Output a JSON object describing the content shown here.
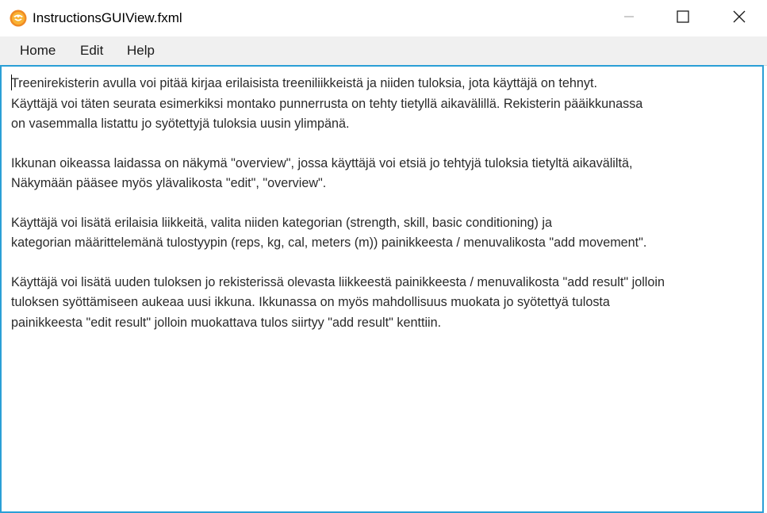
{
  "window": {
    "title": "InstructionsGUIView.fxml",
    "icon": "app-icon",
    "controls": [
      "minimize-icon",
      "maximize-icon",
      "close-icon"
    ]
  },
  "menu": {
    "items": [
      {
        "label": "Home"
      },
      {
        "label": "Edit"
      },
      {
        "label": "Help"
      }
    ]
  },
  "content": {
    "paragraphs": [
      "Treenirekisterin avulla voi pitää kirjaa erilaisista treeniliikkeistä ja niiden tuloksia, jota käyttäjä on tehnyt.\nKäyttäjä voi täten seurata esimerkiksi montako punnerrusta on tehty tietyllä aikavälillä. Rekisterin pääikkunassa\non vasemmalla listattu jo syötettyjä tuloksia uusin ylimpänä.",
      "Ikkunan oikeassa laidassa on näkymä \"overview\", jossa käyttäjä voi etsiä jo tehtyjä tuloksia tietyltä aikaväliltä,\nNäkymään pääsee myös ylävalikosta \"edit\", \"overview\".",
      "Käyttäjä voi lisätä erilaisia liikkeitä, valita niiden kategorian (strength, skill, basic conditioning) ja\nkategorian määrittelemänä tulostyypin (reps, kg, cal, meters (m)) painikkeesta / menuvalikosta \"add movement\".",
      "Käyttäjä voi lisätä uuden tuloksen jo rekisterissä olevasta liikkeestä painikkeesta / menuvalikosta \"add result\" jolloin\ntuloksen syöttämiseen aukeaa uusi ikkuna. Ikkunassa on myös mahdollisuus muokata jo syötettyä tulosta\npainikkeesta \"edit result\" jolloin muokattava tulos siirtyy \"add result\" kenttiin."
    ]
  },
  "colors": {
    "focus_border": "#2a9fd6",
    "menubar_bg": "#f0f0f0",
    "icon_orange": "#f5a623"
  }
}
